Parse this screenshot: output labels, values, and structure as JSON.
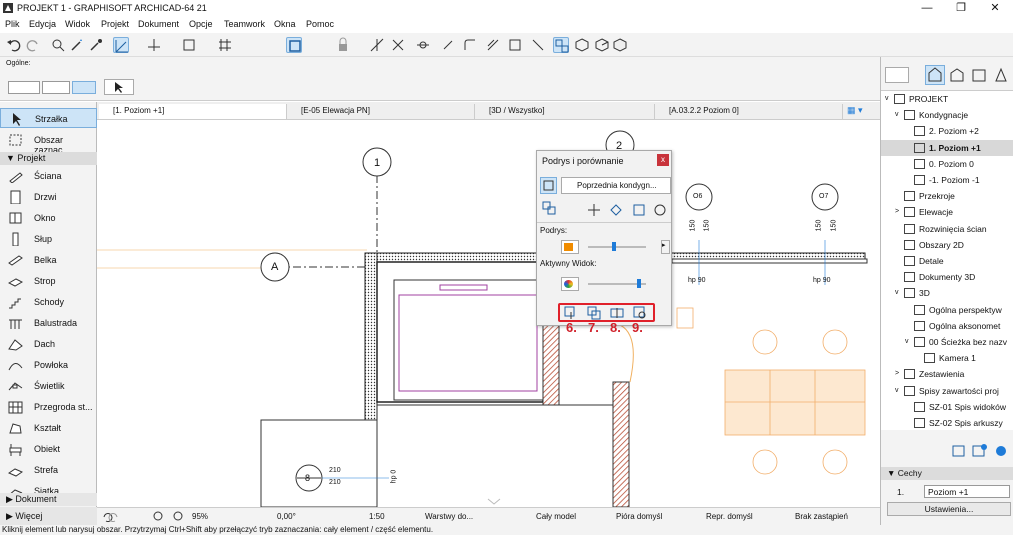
{
  "window": {
    "title": "PROJEKT 1 - GRAPHISOFT ARCHICAD-64 21",
    "minimize": "—",
    "restore": "❐",
    "close": "✕"
  },
  "menu": [
    "Plik",
    "Edycja",
    "Widok",
    "Projekt",
    "Dokument",
    "Opcje",
    "Teamwork",
    "Okna",
    "Pomoc"
  ],
  "infobox": {
    "label": "Ogólne:"
  },
  "toolbox": {
    "selected_tool": "Strzałka",
    "top_items": [
      {
        "label": "Strzałka",
        "icon": "arrow-icon"
      },
      {
        "label": "Obszar zaznac...",
        "icon": "marquee-icon"
      }
    ],
    "section_project": "Projekt",
    "project_items": [
      {
        "label": "Ściana",
        "icon": "wall-icon"
      },
      {
        "label": "Drzwi",
        "icon": "door-icon"
      },
      {
        "label": "Okno",
        "icon": "window-icon"
      },
      {
        "label": "Słup",
        "icon": "column-icon"
      },
      {
        "label": "Belka",
        "icon": "beam-icon"
      },
      {
        "label": "Strop",
        "icon": "slab-icon"
      },
      {
        "label": "Schody",
        "icon": "stair-icon"
      },
      {
        "label": "Balustrada",
        "icon": "railing-icon"
      },
      {
        "label": "Dach",
        "icon": "roof-icon"
      },
      {
        "label": "Powłoka",
        "icon": "shell-icon"
      },
      {
        "label": "Świetlik",
        "icon": "skylight-icon"
      },
      {
        "label": "Przegroda st...",
        "icon": "curtain-wall-icon"
      },
      {
        "label": "Kształt",
        "icon": "morph-icon"
      },
      {
        "label": "Obiekt",
        "icon": "object-icon"
      },
      {
        "label": "Strefa",
        "icon": "zone-icon"
      },
      {
        "label": "Siatka",
        "icon": "mesh-icon"
      }
    ],
    "section_document": "Dokument",
    "section_more": "Więcej"
  },
  "tabs": [
    {
      "label": "[1. Poziom +1]",
      "active": true
    },
    {
      "label": "[E-05 Elewacja PN]"
    },
    {
      "label": "[3D / Wszystko]"
    },
    {
      "label": "[A.03.2.2 Poziom 0]"
    }
  ],
  "drawing": {
    "axis_1": "1",
    "axis_2": "2",
    "axis_A": "A",
    "axis_O6": "O6",
    "axis_O7": "O7",
    "dim_150": "150",
    "hp90": "hp 90",
    "hp0": "hp 0",
    "stair_number": "8",
    "dim_210": "210"
  },
  "dialog": {
    "title": "Podrys i porównanie",
    "close": "x",
    "dropdown": "Poprzednia kondygn...",
    "podrys_label": "Podrys:",
    "active_view_label": "Aktywny Widok:",
    "podrys_color": "#f08c00",
    "highlight_color": "#e0202a",
    "numbers": [
      "6.",
      "7.",
      "8.",
      "9."
    ],
    "podrys_slider": 0.45,
    "active_slider": 0.9
  },
  "statusbar": {
    "zoom": "95%",
    "angle": "0,00°",
    "scale": "1:50",
    "layers": "Warstwy do...",
    "model": "Cały model",
    "pens": "Pióra domyśl",
    "repr": "Repr. domyśl",
    "override": "Brak zastąpień"
  },
  "hint": "Kliknij element lub narysuj obszar. Przytrzymaj Ctrl+Shift aby przełączyć tryb zaznaczania: cały element / część elementu.",
  "navigator": {
    "items": [
      {
        "label": "PROJEKT",
        "level": 0,
        "expand": "v"
      },
      {
        "label": "Kondygnacje",
        "level": 1,
        "expand": "v"
      },
      {
        "label": "2. Poziom +2",
        "level": 2
      },
      {
        "label": "1. Poziom +1",
        "level": 2,
        "selected": true
      },
      {
        "label": "0. Poziom 0",
        "level": 2
      },
      {
        "label": "-1. Poziom -1",
        "level": 2
      },
      {
        "label": "Przekroje",
        "level": 1
      },
      {
        "label": "Elewacje",
        "level": 1,
        "expand": ">"
      },
      {
        "label": "Rozwinięcia ścian",
        "level": 1
      },
      {
        "label": "Obszary 2D",
        "level": 1
      },
      {
        "label": "Detale",
        "level": 1
      },
      {
        "label": "Dokumenty 3D",
        "level": 1
      },
      {
        "label": "3D",
        "level": 1,
        "expand": "v"
      },
      {
        "label": "Ogólna perspektyw",
        "level": 2
      },
      {
        "label": "Ogólna aksonomet",
        "level": 2
      },
      {
        "label": "00 Ścieżka bez nazv",
        "level": 2,
        "expand": "v"
      },
      {
        "label": "Kamera 1",
        "level": 3
      },
      {
        "label": "Zestawienia",
        "level": 1,
        "expand": ">"
      },
      {
        "label": "Spisy zawartości proj",
        "level": 1,
        "expand": "v"
      },
      {
        "label": "SZ-01 Spis widoków",
        "level": 2
      },
      {
        "label": "SZ-02 Spis arkuszy",
        "level": 2
      }
    ],
    "properties_label": "Cechy",
    "story_number": "1.",
    "story_name": "Poziom +1",
    "settings_button": "Ustawienia..."
  }
}
